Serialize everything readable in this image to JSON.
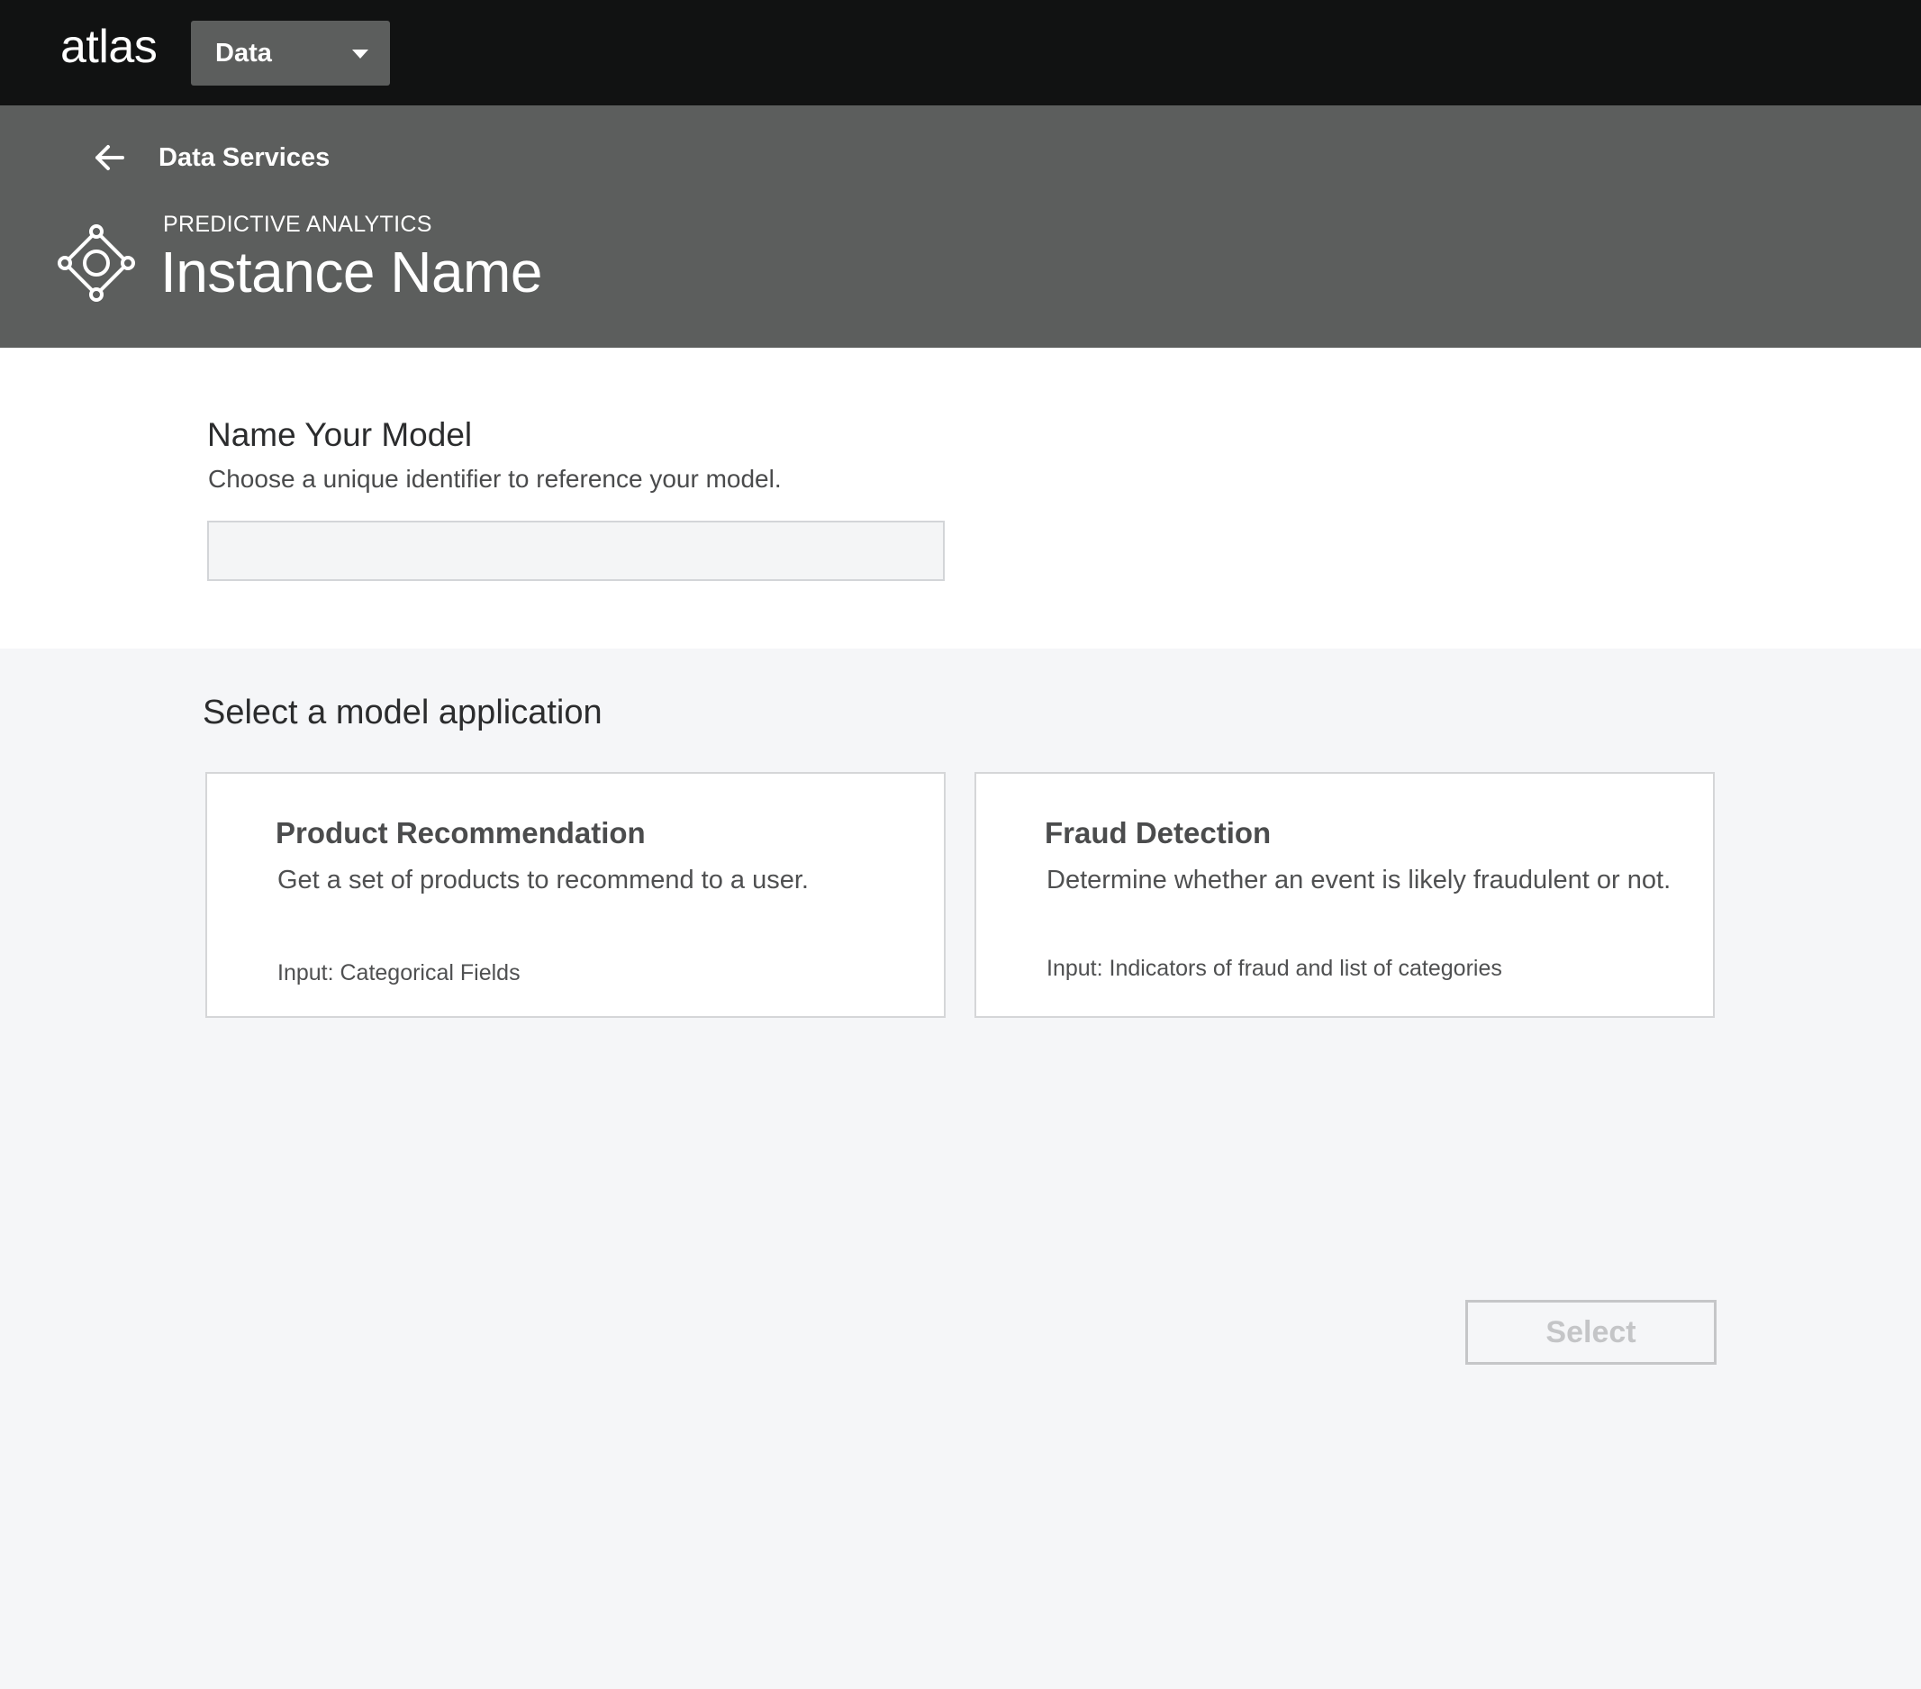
{
  "topbar": {
    "logo_text": "atlas",
    "context_dropdown": {
      "selected": "Data",
      "icon": "chevron-down-icon"
    }
  },
  "header": {
    "back_icon": "arrow-left-icon",
    "back_label": "Data Services",
    "service_icon": "predictive-analytics-icon",
    "eyebrow": "PREDICTIVE ANALYTICS",
    "title": "Instance Name"
  },
  "name_section": {
    "title": "Name Your Model",
    "help_text": "Choose a unique identifier to reference your model.",
    "input_value": "",
    "input_placeholder": ""
  },
  "applications": {
    "title": "Select a model application",
    "cards": [
      {
        "title": "Product Recommendation",
        "description": "Get a set of products to recommend to a user.",
        "input": "Input: Categorical Fields"
      },
      {
        "title": "Fraud Detection",
        "description": "Determine whether an event is likely fraudulent or not.",
        "input": "Input: Indicators of fraud and list of categories"
      }
    ]
  },
  "actions": {
    "select_label": "Select",
    "select_enabled": false
  },
  "colors": {
    "topbar_bg": "#111212",
    "header_bg": "#5c5e5d",
    "page_bg": "#f5f6f8",
    "card_border": "#d5d6d8",
    "disabled_text": "#c4c5c7"
  }
}
